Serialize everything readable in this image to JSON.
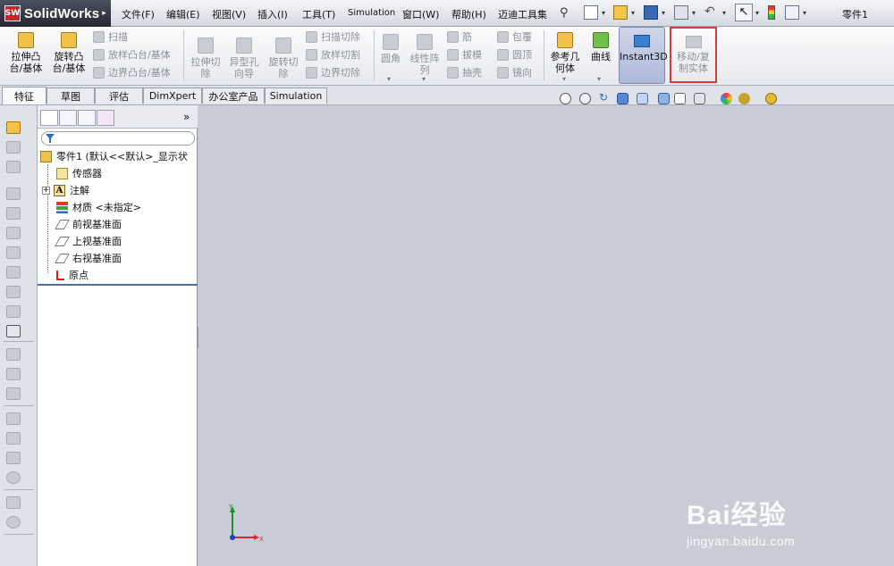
{
  "app": {
    "brand": "SolidWorks",
    "logo_mark": "SW",
    "document_title": "零件1"
  },
  "menu": [
    "文件(F)",
    "编辑(E)",
    "视图(V)",
    "插入(I)",
    "工具(T)",
    "Simulation",
    "窗口(W)",
    "帮助(H)",
    "迈迪工具集"
  ],
  "ribbon": {
    "extrude_boss": "拉伸凸\n台/基体",
    "revolve_boss": "旋转凸\n台/基体",
    "sweep": "扫描",
    "loft_boss": "放样凸台/基体",
    "boundary_boss": "边界凸台/基体",
    "extrude_cut": "拉伸切\n除",
    "hole_wizard": "异型孔\n向导",
    "revolve_cut": "旋转切\n除",
    "sweep_cut": "扫描切除",
    "loft_cut": "放样切割",
    "boundary_cut": "边界切除",
    "fillet": "圆角",
    "linear_pattern": "线性阵\n列",
    "rib": "筋",
    "draft": "拔模",
    "shell": "抽壳",
    "wrap": "包覆",
    "dome": "圆顶",
    "mirror": "镜向",
    "ref_geometry": "参考几\n何体",
    "curves": "曲线",
    "instant3d": "Instant3D",
    "move_copy_body": "移动/复\n制实体"
  },
  "tabs": [
    "特征",
    "草图",
    "评估",
    "DimXpert",
    "办公室产品",
    "Simulation"
  ],
  "tree": {
    "part": "零件1 (默认<<默认>_显示状",
    "items": [
      "传感器",
      "注解",
      "材质 <未指定>",
      "前视基准面",
      "上视基准面",
      "右视基准面",
      "原点"
    ]
  },
  "axes": {
    "y": "Y",
    "x": "X"
  },
  "watermark": {
    "brand": "Bai经验",
    "url": "jingyan.baidu.com"
  },
  "colors": {
    "highlight_border": "#d93a3a",
    "instant3d_bg": "#b8c2de",
    "graphics_bg": "#c9ccd6"
  }
}
